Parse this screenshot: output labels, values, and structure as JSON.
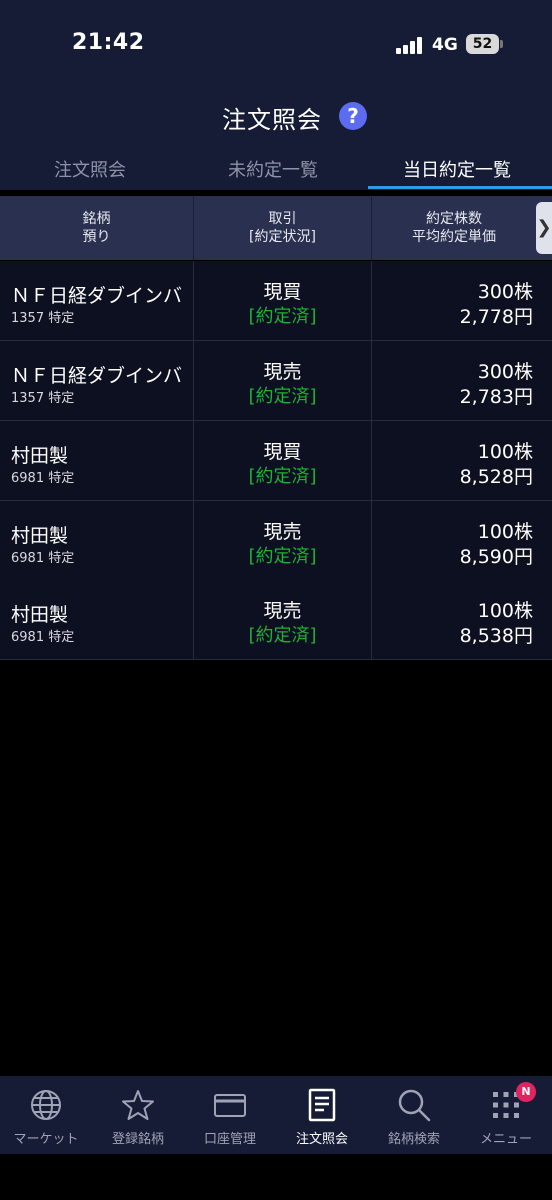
{
  "status_bar": {
    "time": "21:42",
    "network": "4G",
    "battery": "52"
  },
  "header": {
    "title": "注文照会",
    "tabs": [
      {
        "label": "注文照会",
        "active": false
      },
      {
        "label": "未約定一覧",
        "active": false
      },
      {
        "label": "当日約定一覧",
        "active": true
      }
    ]
  },
  "table": {
    "columns": [
      {
        "line1": "銘柄",
        "line2": "預り"
      },
      {
        "line1": "取引",
        "line2": "[約定状況]"
      },
      {
        "line1": "約定株数",
        "line2": "平均約定単価"
      }
    ],
    "rows": [
      {
        "name": "ＮＦ日経ダブインバ",
        "code": "1357 特定",
        "trade": "現買",
        "status": "[約定済]",
        "qty": "300株",
        "price": "2,778円"
      },
      {
        "name": "ＮＦ日経ダブインバ",
        "code": "1357 特定",
        "trade": "現売",
        "status": "[約定済]",
        "qty": "300株",
        "price": "2,783円"
      },
      {
        "name": "村田製",
        "code": "6981 特定",
        "trade": "現買",
        "status": "[約定済]",
        "qty": "100株",
        "price": "8,528円"
      },
      {
        "name": "村田製",
        "code": "6981 特定",
        "trade": "現売",
        "status": "[約定済]",
        "qty": "100株",
        "price": "8,590円"
      },
      {
        "name": "村田製",
        "code": "6981 特定",
        "trade": "現売",
        "status": "[約定済]",
        "qty": "100株",
        "price": "8,538円"
      }
    ]
  },
  "bottom_nav": {
    "items": [
      {
        "label": "マーケット",
        "icon": "globe-icon",
        "active": false
      },
      {
        "label": "登録銘柄",
        "icon": "star-icon",
        "active": false
      },
      {
        "label": "口座管理",
        "icon": "card-icon",
        "active": false
      },
      {
        "label": "注文照会",
        "icon": "document-icon",
        "active": true
      },
      {
        "label": "銘柄検索",
        "icon": "search-icon",
        "active": false
      },
      {
        "label": "メニュー",
        "icon": "grid-menu-icon",
        "active": false
      }
    ],
    "menu_badge": "N"
  },
  "colors": {
    "header_bg": "#161c35",
    "accent": "#2e9be6",
    "executed_green": "#1fb035",
    "help_blue": "#5b6cf0",
    "badge_red": "#e0245e"
  }
}
